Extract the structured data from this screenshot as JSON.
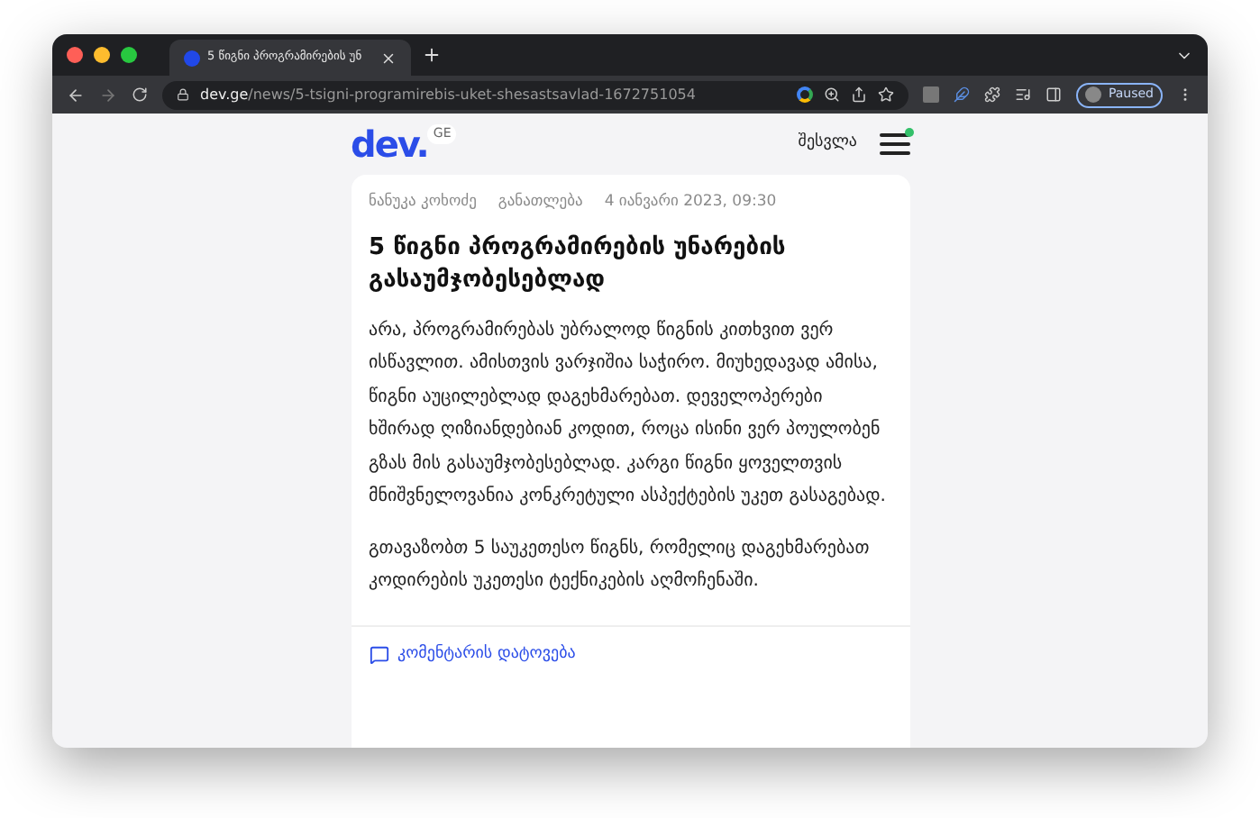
{
  "browser": {
    "tab_title": "5 წიგნი პროგრამირების უნ",
    "url_host": "dev.ge",
    "url_path": "/news/5-tsigni-programirebis-uket-shesastsavlad-1672751054",
    "profile_label": "Paused"
  },
  "header": {
    "logo": "dev.",
    "logo_badge": "GE",
    "login": "შესვლა",
    "menu_notification": true
  },
  "article": {
    "author": "ნანუკა კოხოძე",
    "category": "განათლება",
    "date": "4 იანვარი 2023, 09:30",
    "title": "5 წიგნი პროგრამირების უნარების გასაუმჯობესებლად",
    "paragraphs": [
      "არა, პროგრამირებას უბრალოდ წიგნის კითხვით ვერ ისწავლით. ამისთვის ვარჯიშია საჭირო. მიუხედავად ამისა, წიგნი აუცილებლად დაგეხმარებათ. დეველოპერები ხშირად ღიზიანდებიან კოდით, როცა ისინი ვერ პოულობენ გზას მის გასაუმჯობესებლად. კარგი წიგნი ყოველთვის მნიშვნელოვანია კონკრეტული ასპექტების უკეთ გასაგებად.",
      "გთავაზობთ 5 საუკეთესო წიგნს, რომელიც დაგეხმარებათ კოდირების უკეთესი ტექნიკების აღმოჩენაში."
    ],
    "comment_link": "კომენტარის დატოვება"
  }
}
